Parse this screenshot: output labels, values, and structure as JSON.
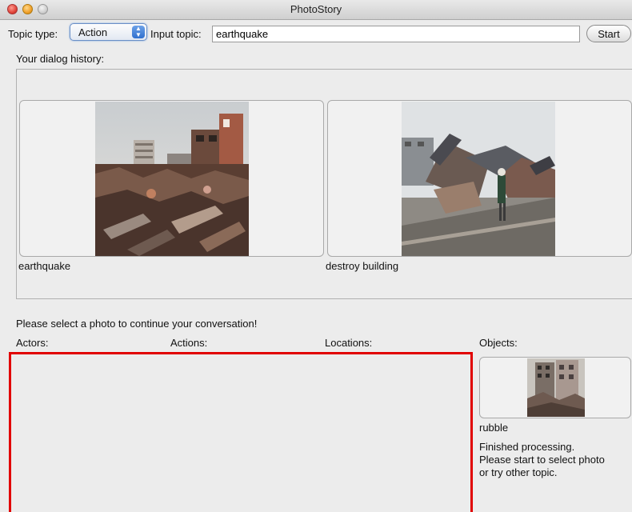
{
  "window": {
    "title": "PhotoStory"
  },
  "toolbar": {
    "topic_type_label": "Topic type:",
    "topic_type_value": "Action",
    "input_topic_label": "Input topic:",
    "input_topic_value": "earthquake",
    "start_label": "Start"
  },
  "history": {
    "label": "Your dialog history:",
    "photos": [
      {
        "caption": "earthquake"
      },
      {
        "caption": "destroy building"
      }
    ]
  },
  "prompt": "Please select a photo to continue your conversation!",
  "columns": {
    "actors": "Actors:",
    "actions": "Actions:",
    "locations": "Locations:",
    "objects": "Objects:"
  },
  "objects": [
    {
      "caption": "rubble"
    }
  ],
  "status": {
    "lines": [
      "Finished processing.",
      "Please start to select photo",
      "or try other topic."
    ]
  },
  "colors": {
    "highlight": "#e10000",
    "accent": "#2f6fce"
  }
}
